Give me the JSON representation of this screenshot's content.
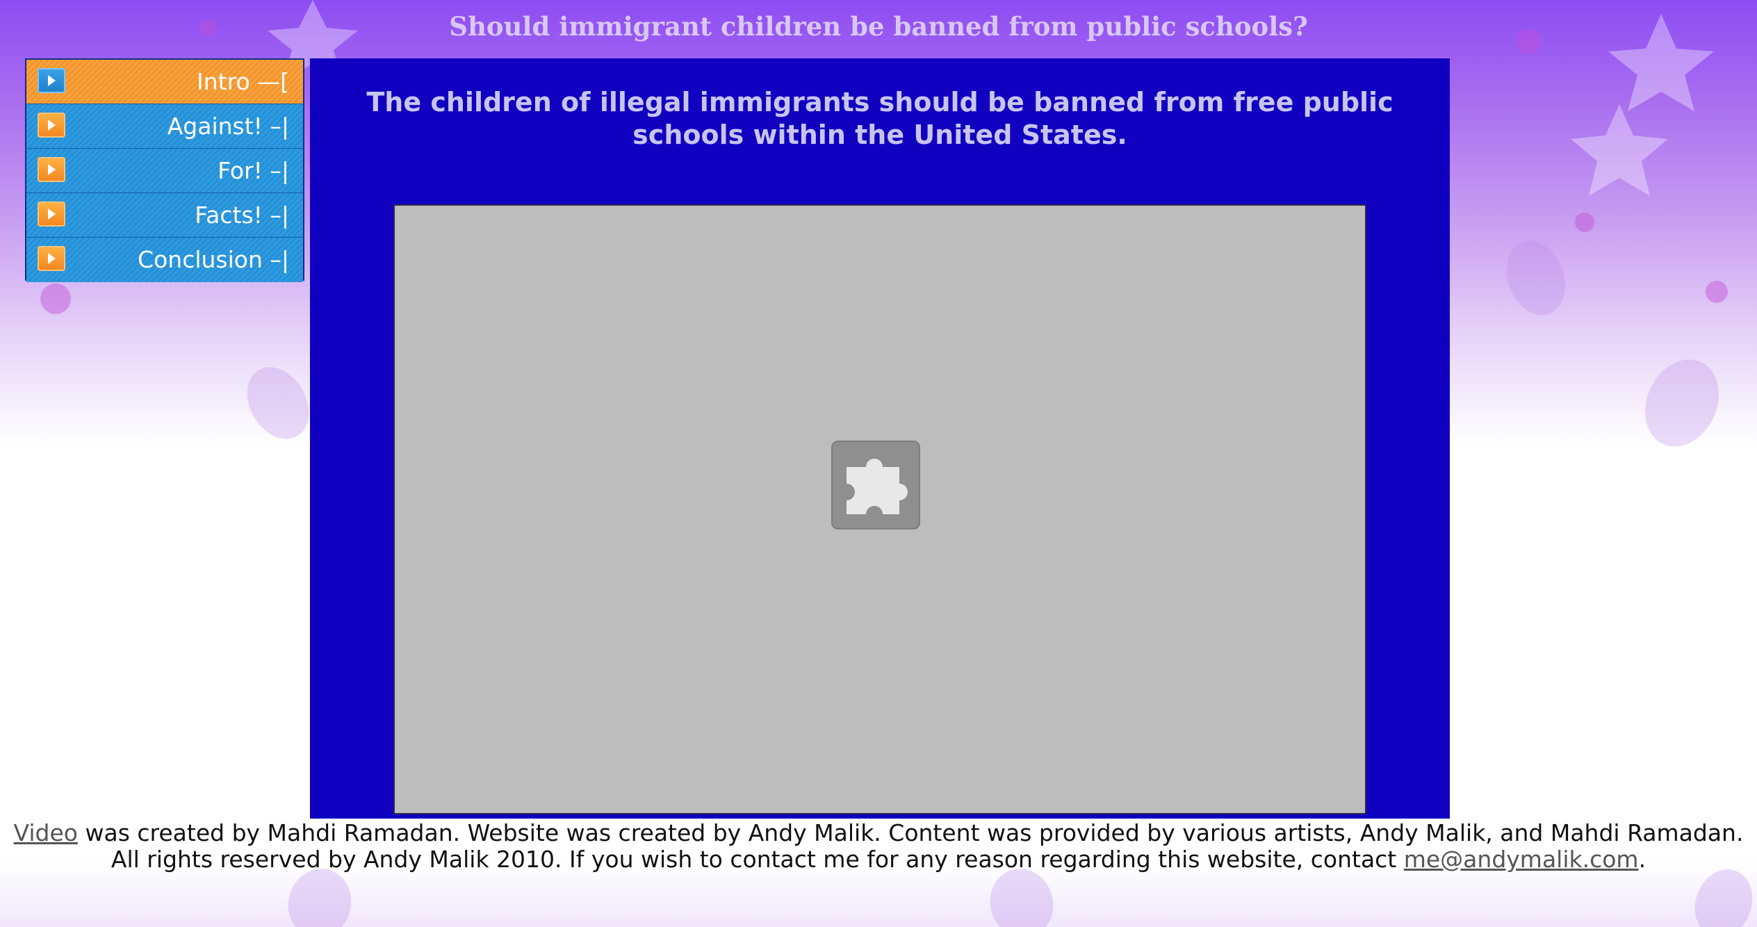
{
  "header": {
    "title": "Should immigrant children be banned from public schools?"
  },
  "menu": {
    "items": [
      {
        "label": "Intro —[",
        "active": true
      },
      {
        "label": "Against! –|",
        "active": false
      },
      {
        "label": "For! –|",
        "active": false
      },
      {
        "label": "Facts! –|",
        "active": false
      },
      {
        "label": "Conclusion –|",
        "active": false
      }
    ]
  },
  "main": {
    "headline_line1": "The children of illegal immigrants should be banned from free public",
    "headline_line2": "schools within the United States.",
    "embed": {
      "icon": "puzzle-plugin-icon"
    }
  },
  "footer": {
    "video_link": "Video",
    "text1": " was created by Mahdi Ramadan. Website was created by Andy Malik. Content was provided by various artists, Andy Malik, and Mahdi Ramadan. All rights reserved by Andy Malik 2010. If you wish to contact me for any reason regarding this website, contact ",
    "email_link": "me@andymalik.com",
    "text2": "."
  },
  "colors": {
    "panel": "#1000c0",
    "menu_active": "#f7a03a",
    "menu_item": "#2f9be0",
    "title": "#d9c7f3"
  }
}
